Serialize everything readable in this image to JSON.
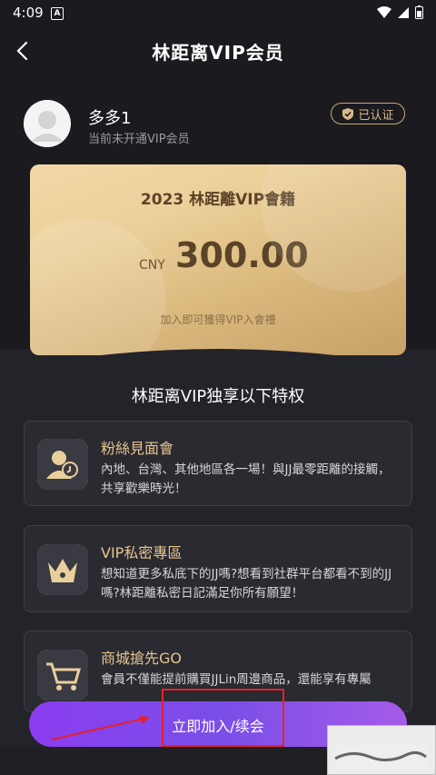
{
  "status": {
    "time": "4:09"
  },
  "header": {
    "title": "林距离VIP会员"
  },
  "user": {
    "name": "多多1",
    "status": "当前未开通VIP会员",
    "verified_badge": "已认证"
  },
  "card": {
    "title": "2023 林距離VIP會籍",
    "currency": "CNY",
    "price": "300.00",
    "subtitle": "加入即可獲得VIP入會禮"
  },
  "section": {
    "title": "林距离VIP独享以下特权"
  },
  "features": [
    {
      "title": "粉絲見面會",
      "desc": "內地、台灣、其他地區各一場！與JJ最零距離的接觸，共享歡樂時光！",
      "icon": "fan-meeting-icon"
    },
    {
      "title": "VIP私密專區",
      "desc": "想知道更多私底下的JJ嗎?想看到社群平台都看不到的JJ嗎?林距離私密日記滿足你所有願望！",
      "icon": "crown-icon"
    },
    {
      "title": "商城搶先GO",
      "desc": "會員不僅能提前購買JJLin周邊商品，還能享有專屬",
      "icon": "shopping-cart-icon"
    }
  ],
  "actions": {
    "join_label": "立即加入/续会"
  },
  "colors": {
    "accent_gold": "#e6c58e",
    "button_purple": "#8b3df0",
    "highlight_red": "#e5212b"
  }
}
